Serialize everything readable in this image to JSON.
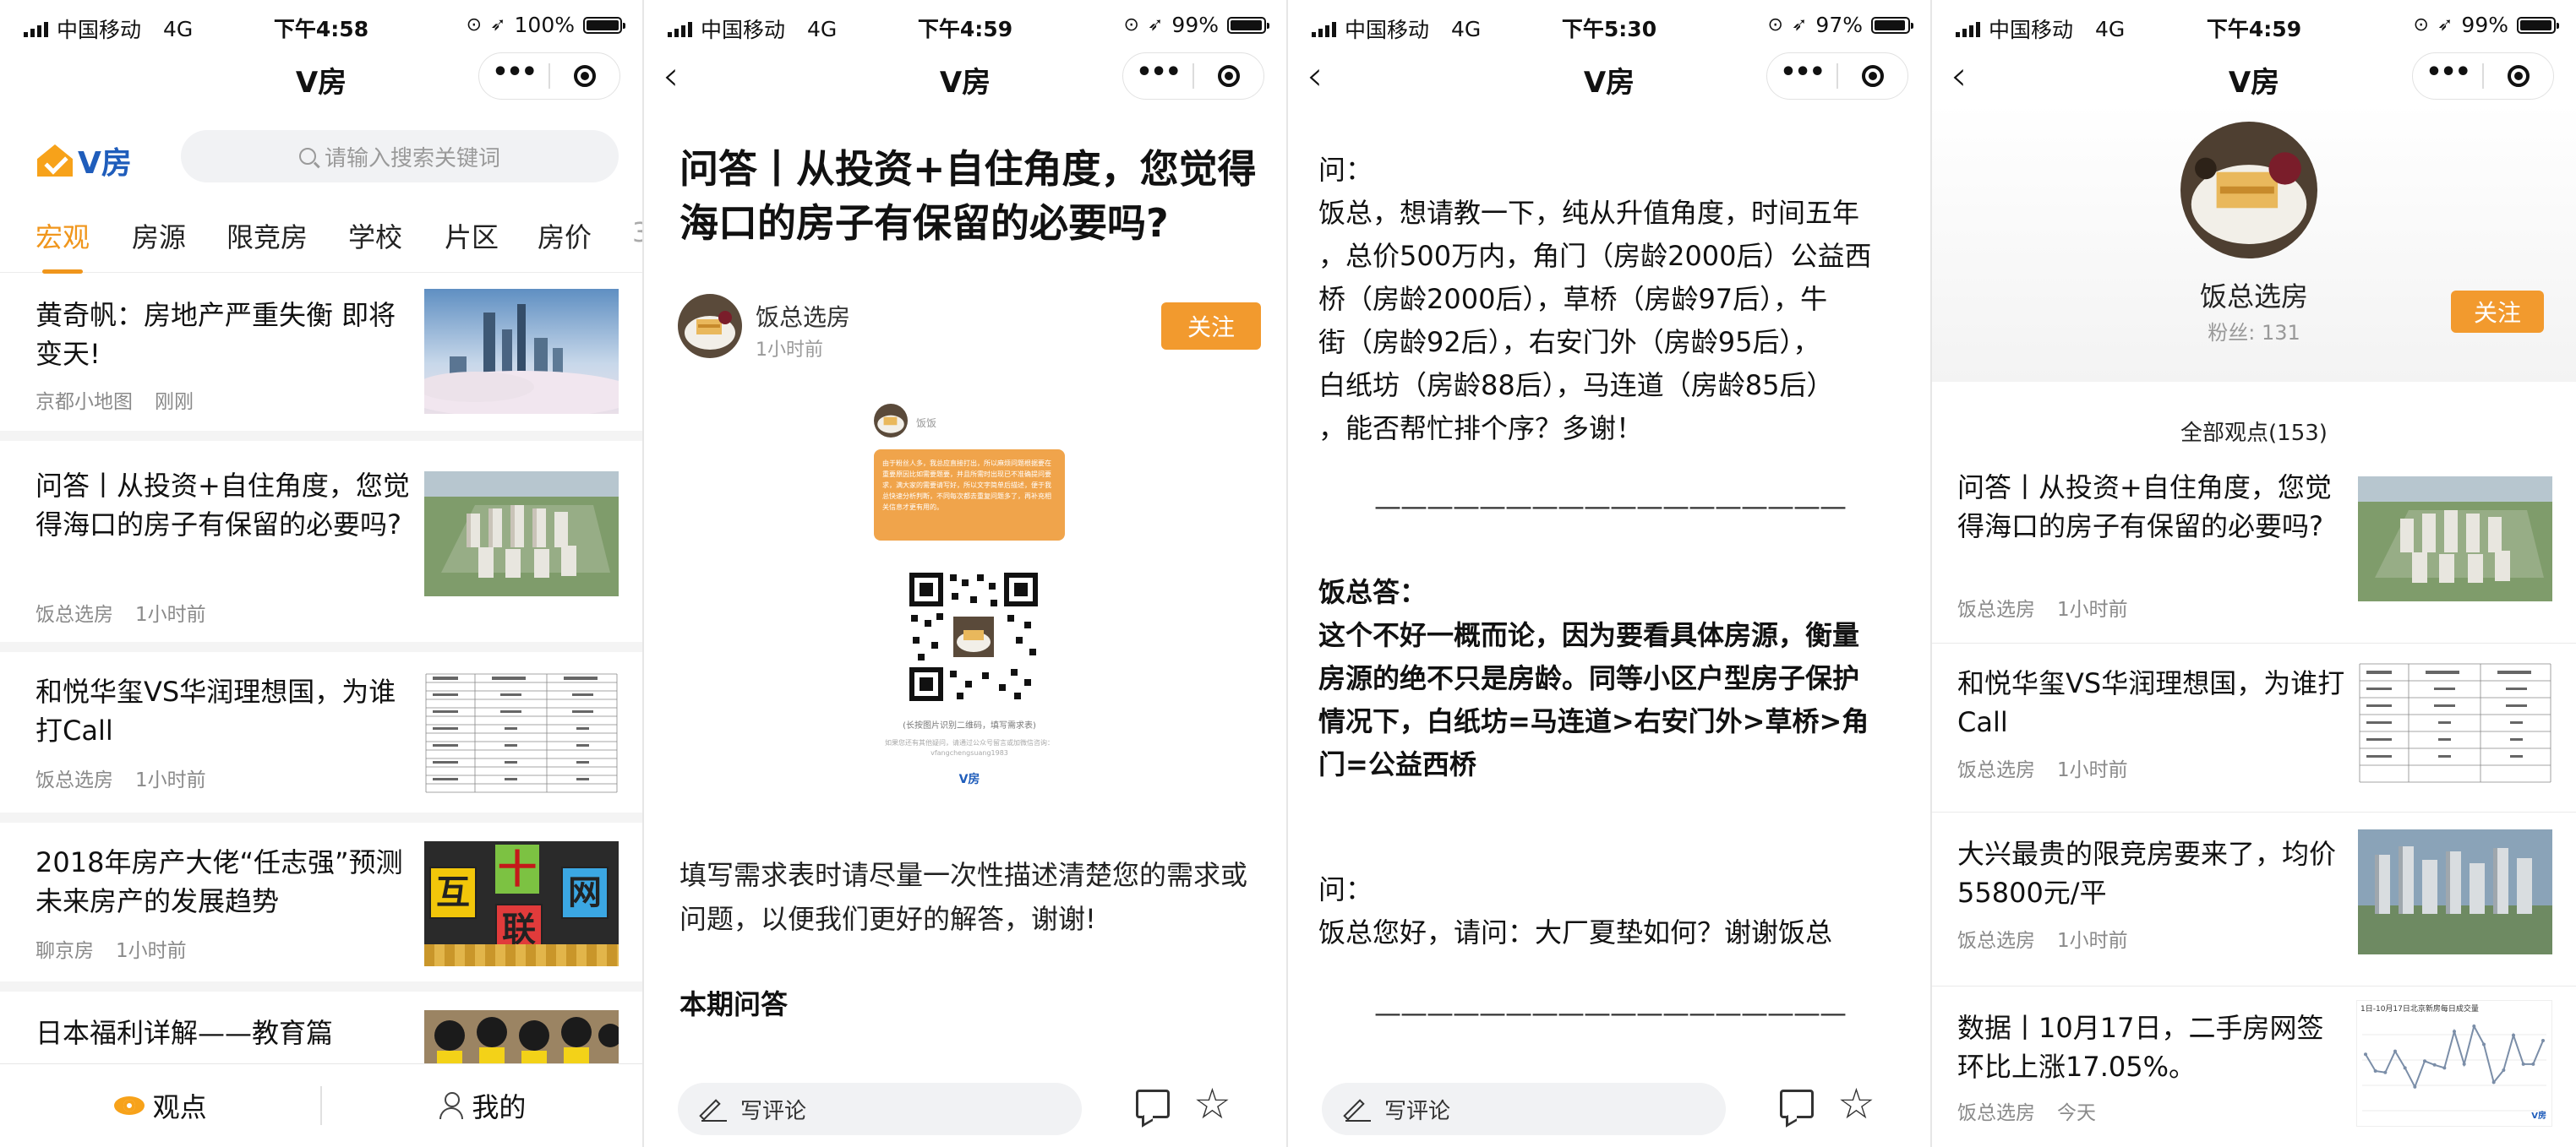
{
  "status_bars": [
    {
      "carrier": "中国移动",
      "network": "4G",
      "time": "下午4:58",
      "battery": "100%",
      "battery_level": 1.0
    },
    {
      "carrier": "中国移动",
      "network": "4G",
      "time": "下午4:59",
      "battery": "99%",
      "battery_level": 0.99
    },
    {
      "carrier": "中国移动",
      "network": "4G",
      "time": "下午5:30",
      "battery": "97%",
      "battery_level": 0.97
    },
    {
      "carrier": "中国移动",
      "network": "4G",
      "time": "下午4:59",
      "battery": "99%",
      "battery_level": 0.99
    }
  ],
  "app_title": "V房",
  "home": {
    "logo_text": "V房",
    "search_placeholder": "请输入搜索关键词",
    "tabs": [
      "宏观",
      "房源",
      "限竞房",
      "学校",
      "片区",
      "房价",
      "3"
    ],
    "feed": [
      {
        "title": "黄奇帆：房地产严重失衡 即将变天!",
        "source": "京都小地图",
        "time": "刚刚"
      },
      {
        "title": "问答丨从投资+自住角度，您觉得海口的房子有保留的必要吗?",
        "source": "饭总选房",
        "time": "1小时前"
      },
      {
        "title": "和悦华玺VS华润理想国，为谁打Call",
        "source": "饭总选房",
        "time": "1小时前"
      },
      {
        "title": "2018年房产大佬“任志强”预测未来房产的发展趋势",
        "source": "聊京房",
        "time": "1小时前"
      },
      {
        "title": "日本福利详解——教育篇",
        "source": "",
        "time": ""
      }
    ],
    "thumb_chars": [
      "互",
      "十",
      "网",
      "联"
    ],
    "tabbar": {
      "views": "观点",
      "mine": "我的"
    }
  },
  "article": {
    "title": "问答丨从投资+自住角度，您觉得海口的房子有保留的必要吗?",
    "author": "饭总选房",
    "time": "1小时前",
    "follow": "关注",
    "card": {
      "name": "饭饭",
      "bubble": "由于粉丝人多，我总应直接打出，所以麻烦问题根据要在重要原因比如需要题要，并且所需时出现已不准确提问要求，满大家的需要请写好，所以文字简单后描述，便于我总快速分析判断，不同每次都去重复问题多了，再补充相关信息才更有用的。",
      "caption": "(长按图片识别二维码，填写需求表)",
      "note": "如果您还有其他疑问，请通过公众号留言或加微信咨询：vfangchengsuang1983",
      "brand": "V房"
    },
    "paragraph": "填写需求表时请尽量一次性描述清楚您的需求或问题，以便我们更好的解答，谢谢!",
    "section": "本期问答",
    "comment_placeholder": "写评论"
  },
  "qa_page": {
    "q1_label": "问：",
    "q1_lines": [
      "饭总，想请教一下，纯从升值角度，时间五年",
      "，总价500万内，角门（房龄2000后）公益西",
      "桥（房龄2000后），草桥（房龄97后），牛",
      "街（房龄92后），右安门外（房龄95后），",
      "白纸坊（房龄88后），马连道（房龄85后）",
      "，能否帮忙排个序？多谢！"
    ],
    "divider": "——————————————————",
    "a1_label": "饭总答：",
    "a1_lines": [
      "这个不好一概而论，因为要看具体房源，衡量",
      "房源的绝不只是房龄。同等小区户型房子保护",
      "情况下，白纸坊=马连道>右安门外>草桥>角",
      "门=公益西桥"
    ],
    "q2_label": "问：",
    "q2_text": "饭总您好，请问：大厂夏垫如何？谢谢饭总",
    "comment_placeholder": "写评论"
  },
  "profile": {
    "name": "饭总选房",
    "fans": "粉丝: 131",
    "follow": "关注",
    "all_views": "全部观点(153)",
    "list": [
      {
        "title": "问答丨从投资+自住角度，您觉得海口的房子有保留的必要吗?",
        "source": "饭总选房",
        "time": "1小时前"
      },
      {
        "title": "和悦华玺VS华润理想国，为谁打Call",
        "source": "饭总选房",
        "time": "1小时前"
      },
      {
        "title": "大兴最贵的限竞房要来了，均价55800元/平",
        "source": "饭总选房",
        "time": "1小时前"
      },
      {
        "title": "数据丨10月17日，二手房网签环比上涨17.05%。",
        "source": "饭总选房",
        "time": "今天"
      }
    ],
    "chart_thumb_title": "1日-10月17日北京新房每日成交量",
    "chart_thumb_values": [
      80,
      58,
      56,
      84,
      62,
      37,
      71,
      66,
      62,
      110,
      67,
      117,
      93,
      43,
      59,
      105,
      67,
      67,
      98
    ],
    "chart_thumb_brand": "V房"
  },
  "colors": {
    "accent": "#f0961c",
    "brand_blue": "#1f5dbb",
    "follow_bg": "#f29a2e"
  }
}
